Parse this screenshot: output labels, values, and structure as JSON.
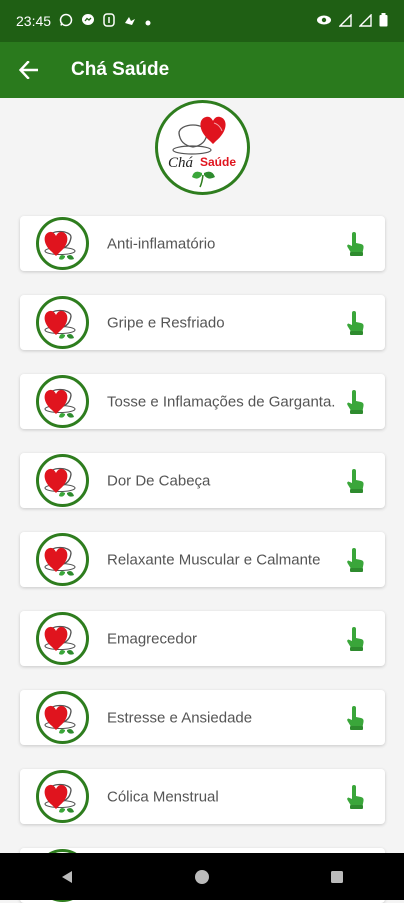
{
  "status_bar": {
    "time": "23:45",
    "left_icons": [
      "whatsapp-icon",
      "messenger-icon",
      "notification-app-icon",
      "bird-notification-icon",
      "dot-icon"
    ],
    "right_icons": [
      "eye-comfort-icon",
      "signal-icon",
      "signal-icon-2",
      "battery-icon"
    ]
  },
  "app_bar": {
    "title": "Chá Saúde",
    "color": "#2a7a1d"
  },
  "logo": {
    "text_cha": "Chá",
    "text_saude": "Saúde"
  },
  "categories": [
    {
      "label": "Anti-inflamatório"
    },
    {
      "label": "Gripe e Resfriado"
    },
    {
      "label": "Tosse e Inflamações de Garganta."
    },
    {
      "label": "Dor De Cabeça"
    },
    {
      "label": "Relaxante Muscular e Calmante"
    },
    {
      "label": "Emagrecedor"
    },
    {
      "label": "Estresse e Ansiedade"
    },
    {
      "label": "Cólica Menstrual"
    }
  ],
  "colors": {
    "primary_dark": "#1f5f14",
    "primary": "#2a7a1d",
    "accent_green": "#3aa63a",
    "heart_red": "#e0141e"
  },
  "nav_bar": {
    "buttons": [
      "back-triangle-icon",
      "home-circle-icon",
      "recents-square-icon"
    ]
  }
}
